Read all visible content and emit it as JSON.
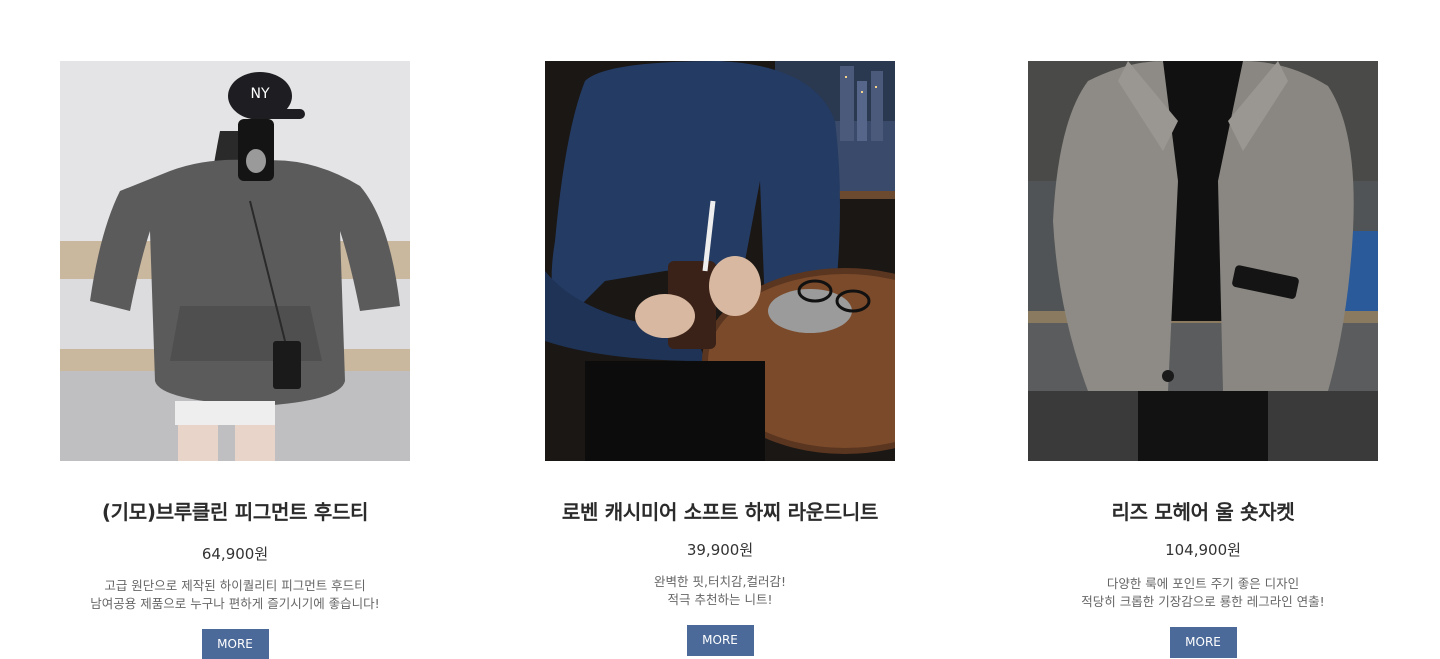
{
  "products": [
    {
      "title": "(기모)브루클린 피그먼트 후드티",
      "price": "64,900원",
      "desc_line1": "고급 원단으로 제작된 하이퀄리티 피그먼트 후드티",
      "desc_line2": "남여공용 제품으로 누구나 편하게 즐기시기에 좋습니다!",
      "button_label": "MORE"
    },
    {
      "title": "로벤 캐시미어 소프트 하찌 라운드니트",
      "price": "39,900원",
      "desc_line1": "완벽한 핏,터치감,컬러감!",
      "desc_line2": "적극 추천하는 니트!",
      "button_label": "MORE"
    },
    {
      "title": "리즈 모헤어 울 숏자켓",
      "price": "104,900원",
      "desc_line1": "다양한 룩에 포인트 주기 좋은 디자인",
      "desc_line2": "적당히 크롭한 기장감으로 룡한 레그라인 연출!",
      "button_label": "MORE"
    }
  ],
  "colors": {
    "button_bg": "#4b6a99",
    "button_text": "#ffffff",
    "title_text": "#2b2b2b",
    "desc_text": "#666666"
  }
}
